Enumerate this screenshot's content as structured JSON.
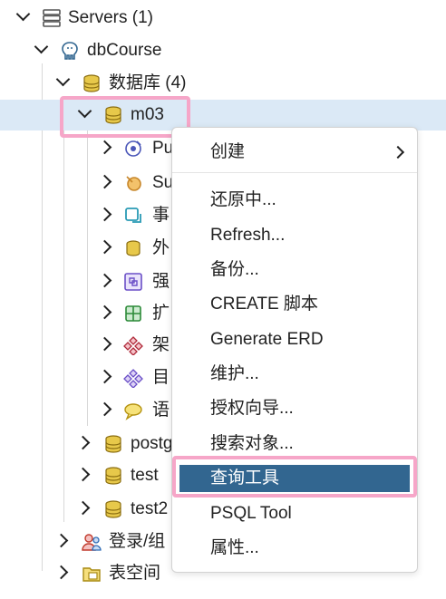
{
  "tree": {
    "servers_label": "Servers (1)",
    "server_label": "dbCourse",
    "databases_label": "数据库 (4)",
    "db_m03_label": "m03",
    "children_partial": [
      "Pu",
      "Su",
      "事",
      "外",
      "强",
      "扩",
      "架",
      "目",
      "语"
    ],
    "db_postgres_label": "postgr",
    "db_test_label": "test",
    "db_test2_label": "test2",
    "login_label": "登录/组",
    "tablespace_label": "表空间"
  },
  "context_menu": {
    "items": [
      "创建",
      "还原中...",
      "Refresh...",
      "备份...",
      "CREATE 脚本",
      "Generate ERD",
      "维护...",
      "授权向导...",
      "搜索对象...",
      "查询工具",
      "PSQL Tool",
      "属性..."
    ],
    "active_item": "查询工具"
  },
  "colors": {
    "selection_row": "#dbe9f6",
    "menu_active": "#326690",
    "highlight_annotation": "#f6a6c8",
    "database_icon": "#c9a227"
  }
}
